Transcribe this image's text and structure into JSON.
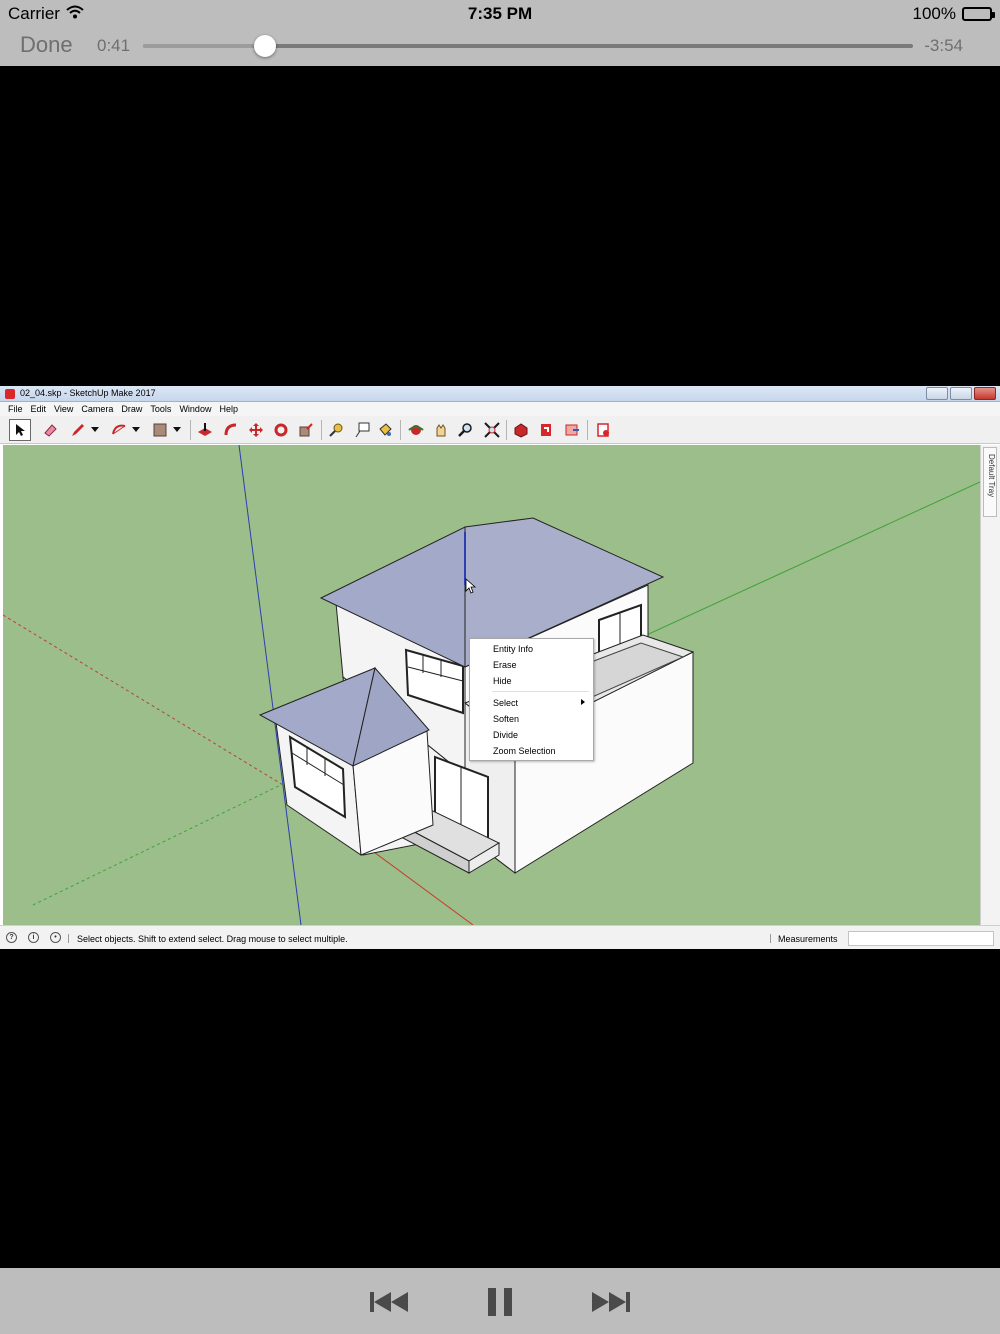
{
  "status_bar": {
    "carrier": "Carrier",
    "time": "7:35 PM",
    "battery": "100%"
  },
  "player": {
    "done_label": "Done",
    "elapsed": "0:41",
    "remaining": "-3:54",
    "progress": 0.158
  },
  "app": {
    "window_title": "02_04.skp - SketchUp Make 2017",
    "menu": [
      "File",
      "Edit",
      "View",
      "Camera",
      "Draw",
      "Tools",
      "Window",
      "Help"
    ],
    "tray_label": "Default Tray",
    "context_menu": {
      "items": [
        "Entity Info",
        "Erase",
        "Hide",
        "Select",
        "Soften",
        "Divide",
        "Zoom Selection"
      ]
    },
    "status_text": "Select objects. Shift to extend select. Drag mouse to select multiple.",
    "measurements_label": "Measurements"
  },
  "icons": {
    "wifi": "wifi-icon",
    "battery": "battery-icon",
    "previous": "skip-back-icon",
    "pause": "pause-icon",
    "next": "skip-forward-icon"
  },
  "colors": {
    "ground": "#9cbe8a",
    "roof": "#a3a9c8",
    "wall": "#f7f7f7",
    "axis_red": "#c83a2e",
    "axis_green": "#3fa23a",
    "axis_blue": "#2c3fb0"
  }
}
